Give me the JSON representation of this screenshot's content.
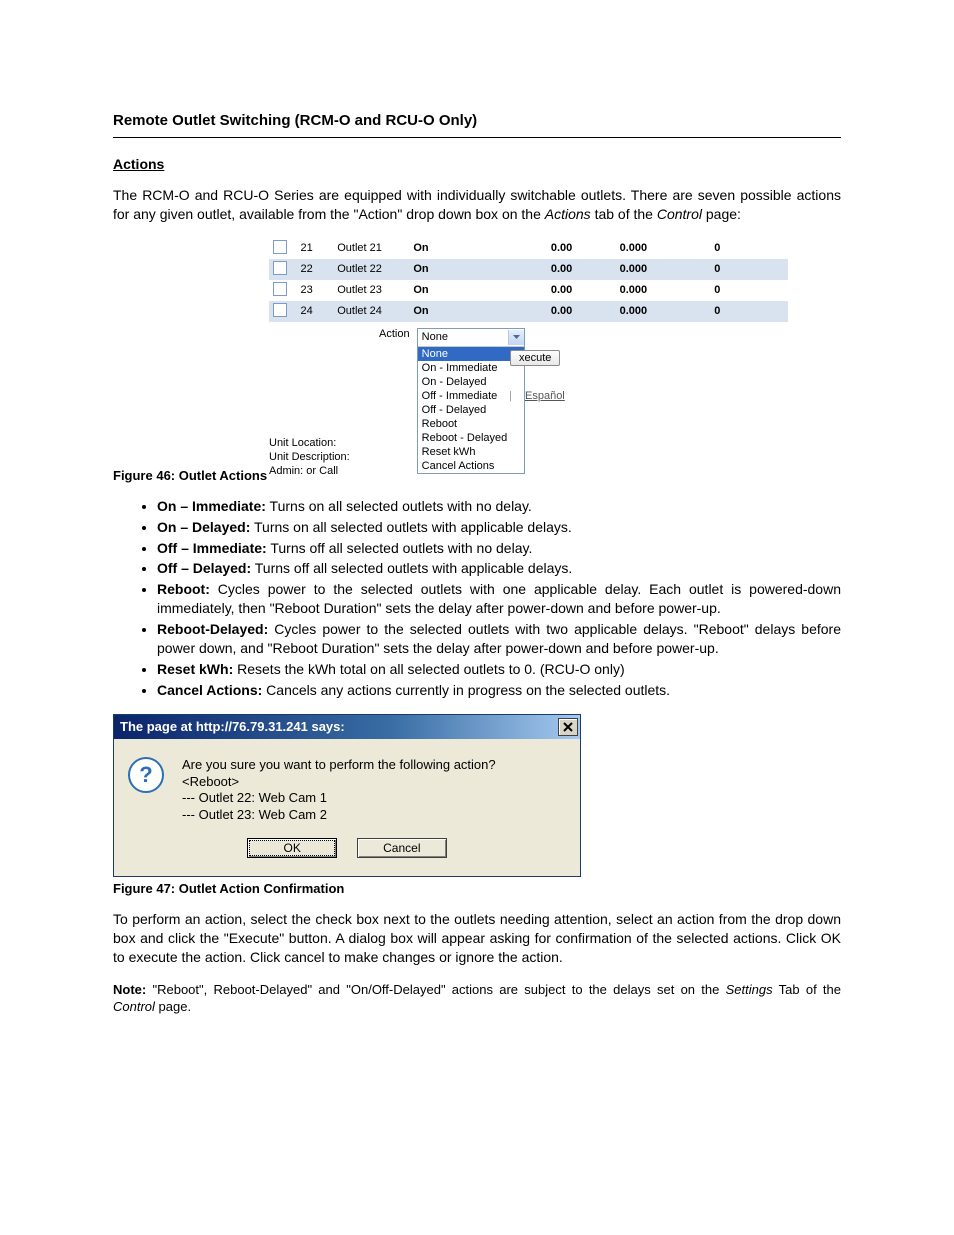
{
  "heading": "Remote Outlet Switching (RCM-O and RCU-O Only)",
  "actions_title": "Actions",
  "intro": "The RCM-O and RCU-O Series are equipped with individually switchable outlets.  There are seven possible actions for any given outlet, available from the \"Action\" drop down box on the ",
  "intro_italic1": "Actions",
  "intro_mid": " tab of the ",
  "intro_italic2": "Control",
  "intro_end": " page:",
  "fig46": {
    "rows": [
      {
        "n": "21",
        "name": "Outlet 21",
        "state": "On",
        "a": "0.00",
        "b": "0.000",
        "c": "0"
      },
      {
        "n": "22",
        "name": "Outlet 22",
        "state": "On",
        "a": "0.00",
        "b": "0.000",
        "c": "0"
      },
      {
        "n": "23",
        "name": "Outlet 23",
        "state": "On",
        "a": "0.00",
        "b": "0.000",
        "c": "0"
      },
      {
        "n": "24",
        "name": "Outlet 24",
        "state": "On",
        "a": "0.00",
        "b": "0.000",
        "c": "0"
      }
    ],
    "action_label": "Action",
    "select_display": "None",
    "options": [
      "None",
      "On - Immediate",
      "On - Delayed",
      "Off - Immediate",
      "Off - Delayed",
      "Reboot",
      "Reboot - Delayed",
      "Reset kWh",
      "Cancel Actions"
    ],
    "execute": "xecute",
    "lang_sep": "|",
    "lang": "Español",
    "unit1": "Unit Location:",
    "unit2": "Unit Description:",
    "unit3": "Admin: or Call"
  },
  "caption46": "Figure 46: Outlet Actions",
  "bullets": [
    {
      "b": "On – Immediate:",
      "t": "  Turns on all selected outlets with no delay."
    },
    {
      "b": "On – Delayed:",
      "t": "  Turns on all selected outlets with applicable delays."
    },
    {
      "b": "Off – Immediate:",
      "t": "  Turns off all selected outlets with no delay."
    },
    {
      "b": "Off – Delayed:",
      "t": "  Turns off all selected outlets with applicable delays."
    },
    {
      "b": "Reboot:",
      "t": "  Cycles power to the selected outlets with one applicable delay.  Each outlet is powered-down immediately, then \"Reboot Duration\" sets the delay after power-down and before power-up."
    },
    {
      "b": "Reboot-Delayed:",
      "t": "  Cycles power to the selected outlets with two applicable delays.  \"Reboot\" delays before power down, and \"Reboot Duration\" sets the delay after power-down and before power-up."
    },
    {
      "b": "Reset kWh:",
      "t": "  Resets the kWh total on all selected outlets to 0. (RCU-O only)"
    },
    {
      "b": "Cancel Actions:",
      "t": "  Cancels any actions currently in progress on the selected outlets."
    }
  ],
  "dialog": {
    "title": "The page at http://76.79.31.241 says:",
    "line1": "Are you sure you want to perform the following action?",
    "line2": "<Reboot>",
    "line3": "--- Outlet 22: Web Cam 1",
    "line4": "--- Outlet 23: Web Cam 2",
    "ok": "OK",
    "cancel": "Cancel"
  },
  "caption47": "Figure 47: Outlet Action Confirmation",
  "para2": "To perform an action, select the check box next to the outlets needing attention, select an action from the drop down box and click the \"Execute\" button.  A dialog box will appear asking for confirmation of the selected actions.  Click OK to execute the action.  Click cancel to make changes or ignore the action.",
  "note_label": "Note:",
  "note_text_a": " \"Reboot\", Reboot-Delayed\" and \"On/Off-Delayed\" actions are subject to the delays set on the ",
  "note_italic1": "Settings",
  "note_mid": " Tab of the ",
  "note_italic2": "Control",
  "note_end": " page."
}
